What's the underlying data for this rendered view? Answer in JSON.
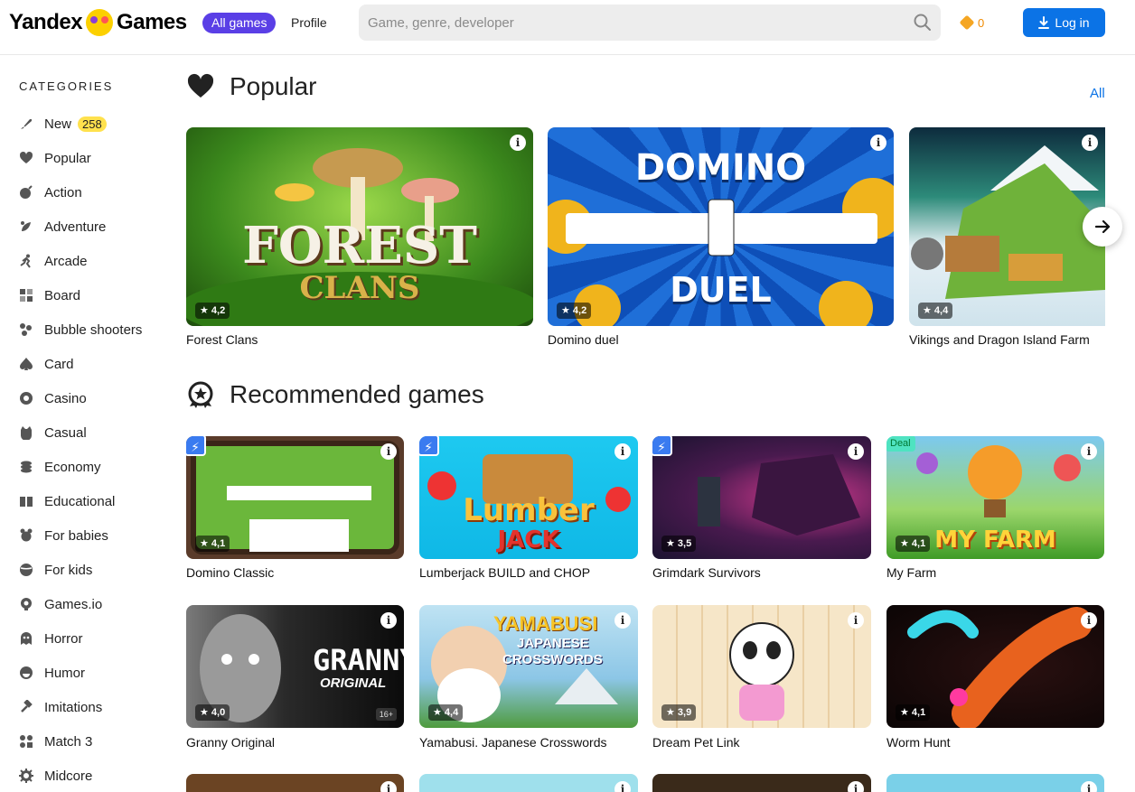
{
  "header": {
    "logo_left": "Yandex",
    "logo_right": "Games",
    "nav_all": "All games",
    "nav_profile": "Profile",
    "search_placeholder": "Game, genre, developer",
    "coins": "0",
    "login": "Log in"
  },
  "sidebar": {
    "title": "CATEGORIES",
    "items": [
      {
        "label": "New",
        "icon": "rocket-icon",
        "badge": "258"
      },
      {
        "label": "Popular",
        "icon": "heart-icon"
      },
      {
        "label": "Action",
        "icon": "bomb-icon"
      },
      {
        "label": "Adventure",
        "icon": "compass-icon"
      },
      {
        "label": "Arcade",
        "icon": "runner-icon"
      },
      {
        "label": "Board",
        "icon": "board-icon"
      },
      {
        "label": "Bubble shooters",
        "icon": "bubbles-icon"
      },
      {
        "label": "Card",
        "icon": "spade-icon"
      },
      {
        "label": "Casino",
        "icon": "chip-icon"
      },
      {
        "label": "Casual",
        "icon": "cat-icon"
      },
      {
        "label": "Economy",
        "icon": "coins-icon"
      },
      {
        "label": "Educational",
        "icon": "book-icon"
      },
      {
        "label": "For babies",
        "icon": "teddy-icon"
      },
      {
        "label": "For kids",
        "icon": "ball-icon"
      },
      {
        "label": "Games.io",
        "icon": "io-icon"
      },
      {
        "label": "Horror",
        "icon": "ghost-icon"
      },
      {
        "label": "Humor",
        "icon": "smile-icon"
      },
      {
        "label": "Imitations",
        "icon": "hammer-icon"
      },
      {
        "label": "Match 3",
        "icon": "match3-icon"
      },
      {
        "label": "Midcore",
        "icon": "gear-icon"
      }
    ]
  },
  "popular": {
    "title": "Popular",
    "all": "All",
    "games": [
      {
        "title": "Forest Clans",
        "rating": "★ 4,2",
        "cover_line1": "FOREST",
        "cover_line2": "CLANS"
      },
      {
        "title": "Domino duel",
        "rating": "★ 4,2",
        "cover_line1": "DOMINO",
        "cover_line2": "DUEL"
      },
      {
        "title": "Vikings and Dragon Island Farm",
        "rating": "★ 4,4"
      }
    ]
  },
  "recommended": {
    "title": "Recommended games",
    "games": [
      {
        "title": "Domino Classic",
        "rating": "★ 4,1"
      },
      {
        "title": "Lumberjack BUILD and CHOP",
        "cover_line1": "Lumber",
        "cover_line2": "JACK"
      },
      {
        "title": "Grimdark Survivors",
        "rating": "★ 3,5"
      },
      {
        "title": "My Farm",
        "rating": "★ 4,1",
        "deal": "Deal",
        "cover_line1": "MY FARM"
      },
      {
        "title": "Granny Original",
        "rating": "★ 4,0",
        "age": "16+",
        "cover_line1": "GRANNY",
        "cover_line2": "ORIGINAL"
      },
      {
        "title": "Yamabusi. Japanese Crosswords",
        "rating": "★ 4,4",
        "cover_line1": "YAMABUSI",
        "cover_line2": "JAPANESE",
        "cover_line3": "CROSSWORDS"
      },
      {
        "title": "Dream Pet Link",
        "rating": "★ 3,9"
      },
      {
        "title": "Worm Hunt",
        "rating": "★ 4,1"
      }
    ]
  },
  "colors": {
    "accent": "#5a3fe6",
    "login_blue": "#0b73e6",
    "new_badge": "#ffe14d"
  }
}
